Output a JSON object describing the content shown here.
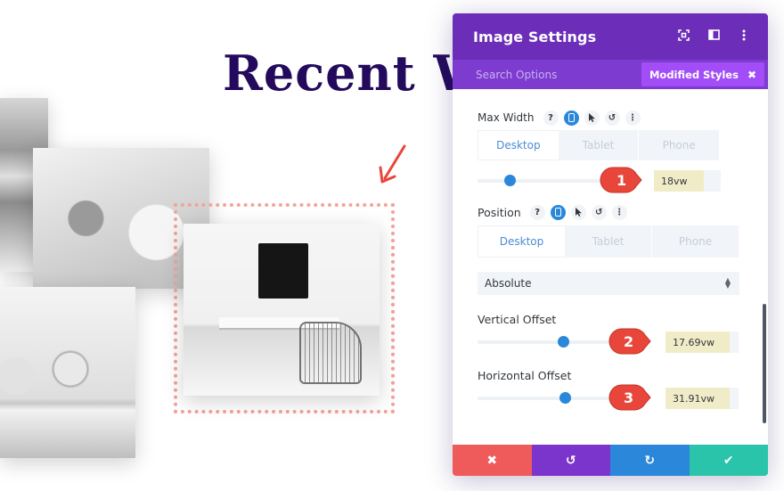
{
  "page": {
    "heading": "Recent W",
    "annotation_arrow_color": "#e8463a",
    "selection_outline_color": "#f2a39a"
  },
  "panel": {
    "title": "Image Settings",
    "header_icons": [
      "fullscreen-icon",
      "split-view-icon",
      "more-options-icon"
    ],
    "search_placeholder": "Search Options",
    "modified_styles_label": "Modified Styles",
    "modified_styles_close": "✖",
    "colors": {
      "header": "#6c2eb9",
      "subbar": "#7d3bcf",
      "chip": "#a24df7",
      "accent_blue": "#2b87da",
      "value_highlight": "#f1ecc8",
      "badge_red": "#e8463a"
    },
    "max_width": {
      "label": "Max Width",
      "tabs": [
        "Desktop",
        "Tablet",
        "Phone"
      ],
      "active_tab": "Desktop",
      "value": "18vw",
      "slider_fraction": 0.25,
      "badge": "1"
    },
    "position": {
      "label": "Position",
      "tabs": [
        "Desktop",
        "Tablet",
        "Phone"
      ],
      "active_tab": "Desktop",
      "select_value": "Absolute"
    },
    "vertical_offset": {
      "label": "Vertical Offset",
      "value": "17.69vw",
      "slider_fraction": 0.6,
      "badge": "2"
    },
    "horizontal_offset": {
      "label": "Horizontal Offset",
      "value": "31.91vw",
      "slider_fraction": 0.61,
      "badge": "3"
    },
    "field_icons": {
      "help": "?",
      "reset": "↺",
      "more": "⋮"
    },
    "footer": {
      "cancel": "✖",
      "undo": "↺",
      "redo": "↻",
      "save": "✔",
      "colors": [
        "#ef5a5a",
        "#7b35cc",
        "#2b87da",
        "#29c4a9"
      ]
    }
  }
}
